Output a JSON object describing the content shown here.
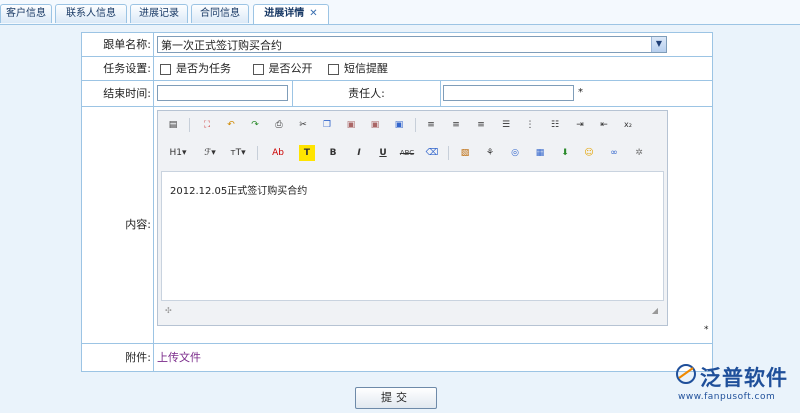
{
  "tabs": [
    {
      "label": "客户信息"
    },
    {
      "label": "联系人信息"
    },
    {
      "label": "进展记录"
    },
    {
      "label": "合同信息"
    },
    {
      "label": "进展详情",
      "close": "✕"
    }
  ],
  "form": {
    "follow_label": "跟单名称:",
    "follow_value": "第一次正式签订购买合约",
    "task_label": "任务设置:",
    "task_options": [
      "是否为任务",
      "是否公开",
      "短信提醒"
    ],
    "end_label": "结束时间:",
    "owner_label": "责任人:",
    "required_mark": "*",
    "content_label": "内容:",
    "content_text": "2012.12.05正式签订购买合约",
    "attach_label": "附件:",
    "attach_link": "上传文件"
  },
  "submit_label": "提交",
  "logo": {
    "name": "泛普软件",
    "url": "www.fanpusoft.com",
    "brand_color": "#1f4f9a"
  }
}
